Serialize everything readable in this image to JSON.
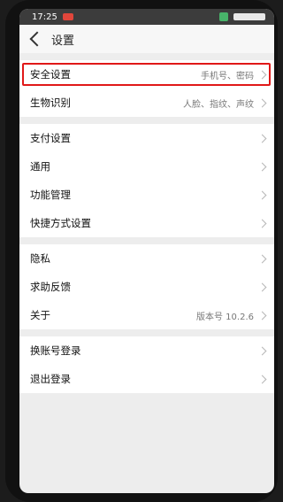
{
  "status": {
    "time": "17:25"
  },
  "appbar": {
    "title": "设置"
  },
  "groups": [
    {
      "rows": [
        {
          "label": "安全设置",
          "value": "手机号、密码"
        },
        {
          "label": "生物识别",
          "value": "人脸、指纹、声纹"
        }
      ]
    },
    {
      "rows": [
        {
          "label": "支付设置"
        },
        {
          "label": "通用"
        },
        {
          "label": "功能管理"
        },
        {
          "label": "快捷方式设置"
        }
      ]
    },
    {
      "rows": [
        {
          "label": "隐私"
        },
        {
          "label": "求助反馈"
        },
        {
          "label": "关于",
          "value": "版本号 10.2.6"
        }
      ]
    },
    {
      "rows": [
        {
          "label": "换账号登录"
        },
        {
          "label": "退出登录"
        }
      ]
    }
  ],
  "colors": {
    "highlight": "#e01818",
    "background": "#ededed"
  }
}
